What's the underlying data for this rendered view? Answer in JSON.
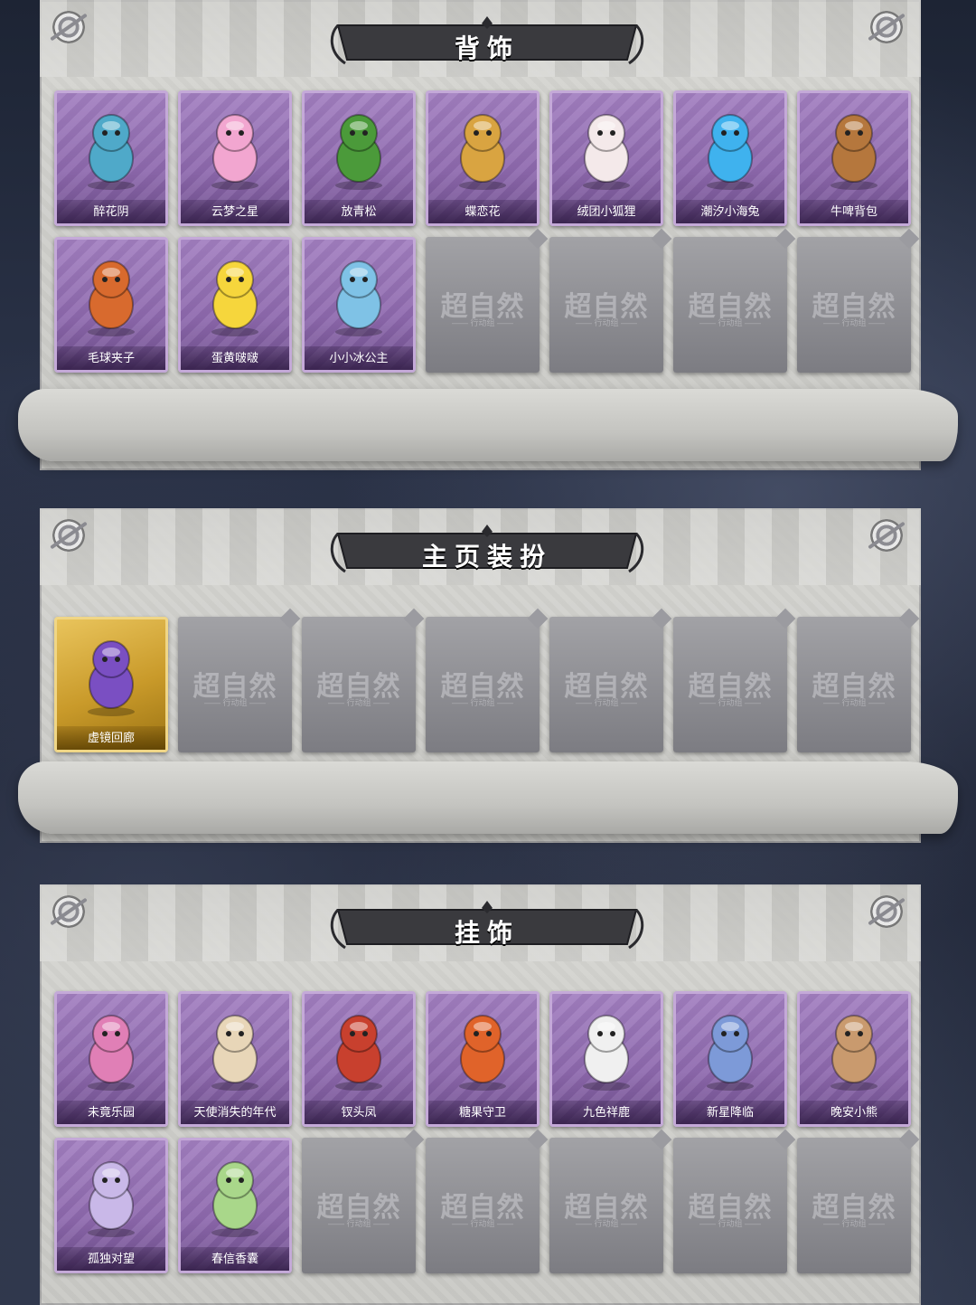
{
  "sections": [
    {
      "title": "背饰",
      "items": [
        {
          "label": "醉花阴",
          "icon": "lantern-ornament-icon",
          "color": "#4fa9c9",
          "style": "purple"
        },
        {
          "label": "云梦之星",
          "icon": "unicorn-icon",
          "color": "#f2a6d0",
          "style": "purple"
        },
        {
          "label": "放青松",
          "icon": "bonsai-tree-icon",
          "color": "#4b9a3a",
          "style": "purple"
        },
        {
          "label": "蝶恋花",
          "icon": "bell-wreath-icon",
          "color": "#d9a441",
          "style": "purple"
        },
        {
          "label": "绒团小狐狸",
          "icon": "white-fox-icon",
          "color": "#f4e9ea",
          "style": "purple"
        },
        {
          "label": "潮汐小海兔",
          "icon": "blue-sea-rabbit-icon",
          "color": "#3fb2ee",
          "style": "purple"
        },
        {
          "label": "牛啤背包",
          "icon": "beer-barrel-cow-icon",
          "color": "#b5773d",
          "style": "purple"
        },
        {
          "label": "毛球夹子",
          "icon": "raccoon-drummer-icon",
          "color": "#d86a2e",
          "style": "purple"
        },
        {
          "label": "蛋黄啵啵",
          "icon": "chick-in-egg-icon",
          "color": "#f6d63c",
          "style": "purple"
        },
        {
          "label": "小小冰公主",
          "icon": "ice-princess-icon",
          "color": "#7fc2e6",
          "style": "purple"
        },
        {
          "label": "",
          "icon": "",
          "color": "",
          "style": "empty"
        },
        {
          "label": "",
          "icon": "",
          "color": "",
          "style": "empty"
        },
        {
          "label": "",
          "icon": "",
          "color": "",
          "style": "empty"
        },
        {
          "label": "",
          "icon": "",
          "color": "",
          "style": "empty"
        }
      ]
    },
    {
      "title": "主页装扮",
      "items": [
        {
          "label": "虚镜回廊",
          "icon": "mirror-card-icon",
          "color": "#7a4fc2",
          "style": "gold"
        },
        {
          "label": "",
          "icon": "",
          "color": "",
          "style": "empty"
        },
        {
          "label": "",
          "icon": "",
          "color": "",
          "style": "empty"
        },
        {
          "label": "",
          "icon": "",
          "color": "",
          "style": "empty"
        },
        {
          "label": "",
          "icon": "",
          "color": "",
          "style": "empty"
        },
        {
          "label": "",
          "icon": "",
          "color": "",
          "style": "empty"
        },
        {
          "label": "",
          "icon": "",
          "color": "",
          "style": "empty"
        }
      ]
    },
    {
      "title": "挂饰",
      "items": [
        {
          "label": "未竟乐园",
          "icon": "pink-doll-icon",
          "color": "#e07fb6",
          "style": "purple"
        },
        {
          "label": "天使消失的年代",
          "icon": "angel-doll-icon",
          "color": "#e8d6b8",
          "style": "purple"
        },
        {
          "label": "钗头凤",
          "icon": "phoenix-crown-doll-icon",
          "color": "#c8402e",
          "style": "purple"
        },
        {
          "label": "糖果守卫",
          "icon": "pumpkin-guard-icon",
          "color": "#e0632a",
          "style": "purple"
        },
        {
          "label": "九色祥鹿",
          "icon": "deer-charm-icon",
          "color": "#f0f0f0",
          "style": "purple"
        },
        {
          "label": "新星降临",
          "icon": "star-doll-icon",
          "color": "#7d9ad8",
          "style": "purple"
        },
        {
          "label": "晚安小熊",
          "icon": "bear-charm-icon",
          "color": "#c99a6e",
          "style": "purple"
        },
        {
          "label": "孤独对望",
          "icon": "lonely-doll-icon",
          "color": "#c9b8e8",
          "style": "purple"
        },
        {
          "label": "春信香囊",
          "icon": "sachet-icon",
          "color": "#a9d78a",
          "style": "purple"
        },
        {
          "label": "",
          "icon": "",
          "color": "",
          "style": "empty"
        },
        {
          "label": "",
          "icon": "",
          "color": "",
          "style": "empty"
        },
        {
          "label": "",
          "icon": "",
          "color": "",
          "style": "empty"
        },
        {
          "label": "",
          "icon": "",
          "color": "",
          "style": "empty"
        },
        {
          "label": "",
          "icon": "",
          "color": "",
          "style": "empty"
        }
      ]
    }
  ],
  "placeholder": {
    "watermark": "超自然",
    "watermark_sub": "—— 行动组 ——"
  }
}
